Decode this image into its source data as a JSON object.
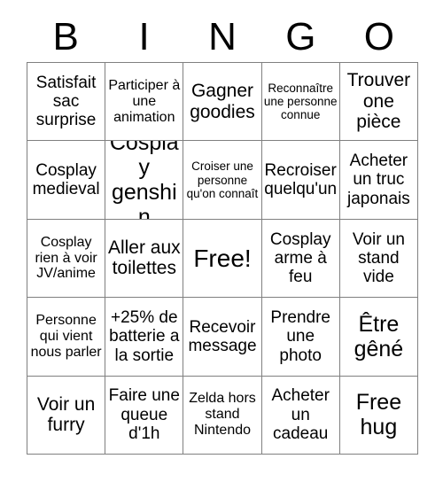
{
  "card": {
    "title": "BINGO",
    "header_letters": [
      "B",
      "I",
      "N",
      "G",
      "O"
    ],
    "grid_size": 5,
    "free_space_index": 12,
    "colors": {
      "text": "#000000",
      "background": "#ffffff",
      "grid_line": "#808080"
    },
    "cells": [
      {
        "text": "Satisfait sac surprise",
        "size": "md",
        "free": false
      },
      {
        "text": "Participer à une animation",
        "size": "sm",
        "free": false
      },
      {
        "text": "Gagner goodies",
        "size": "lg",
        "free": false
      },
      {
        "text": "Reconnaître une personne connue",
        "size": "xs",
        "free": false
      },
      {
        "text": "Trouver one pièce",
        "size": "lg",
        "free": false
      },
      {
        "text": "Cosplay medieval",
        "size": "md",
        "free": false
      },
      {
        "text": "Cosplay genshin",
        "size": "xl",
        "free": false
      },
      {
        "text": "Croiser une personne qu'on connaît",
        "size": "xs",
        "free": false
      },
      {
        "text": "Recroiser quelqu'un",
        "size": "md",
        "free": false
      },
      {
        "text": "Acheter un truc japonais",
        "size": "md",
        "free": false
      },
      {
        "text": "Cosplay rien à voir JV/anime",
        "size": "sm",
        "free": false
      },
      {
        "text": "Aller aux toilettes",
        "size": "lg",
        "free": false
      },
      {
        "text": "Free!",
        "size": "free",
        "free": true
      },
      {
        "text": "Cosplay arme à feu",
        "size": "md",
        "free": false
      },
      {
        "text": "Voir un stand vide",
        "size": "md",
        "free": false
      },
      {
        "text": "Personne qui vient nous parler",
        "size": "sm",
        "free": false
      },
      {
        "text": "+25% de batterie a la sortie",
        "size": "md",
        "free": false
      },
      {
        "text": "Recevoir message",
        "size": "md",
        "free": false
      },
      {
        "text": "Prendre une photo",
        "size": "md",
        "free": false
      },
      {
        "text": "Être gêné",
        "size": "xl",
        "free": false
      },
      {
        "text": "Voir un furry",
        "size": "lg",
        "free": false
      },
      {
        "text": "Faire une queue d'1h",
        "size": "md",
        "free": false
      },
      {
        "text": "Zelda hors stand Nintendo",
        "size": "sm",
        "free": false
      },
      {
        "text": "Acheter un cadeau",
        "size": "md",
        "free": false
      },
      {
        "text": "Free hug",
        "size": "xl",
        "free": false
      }
    ]
  }
}
